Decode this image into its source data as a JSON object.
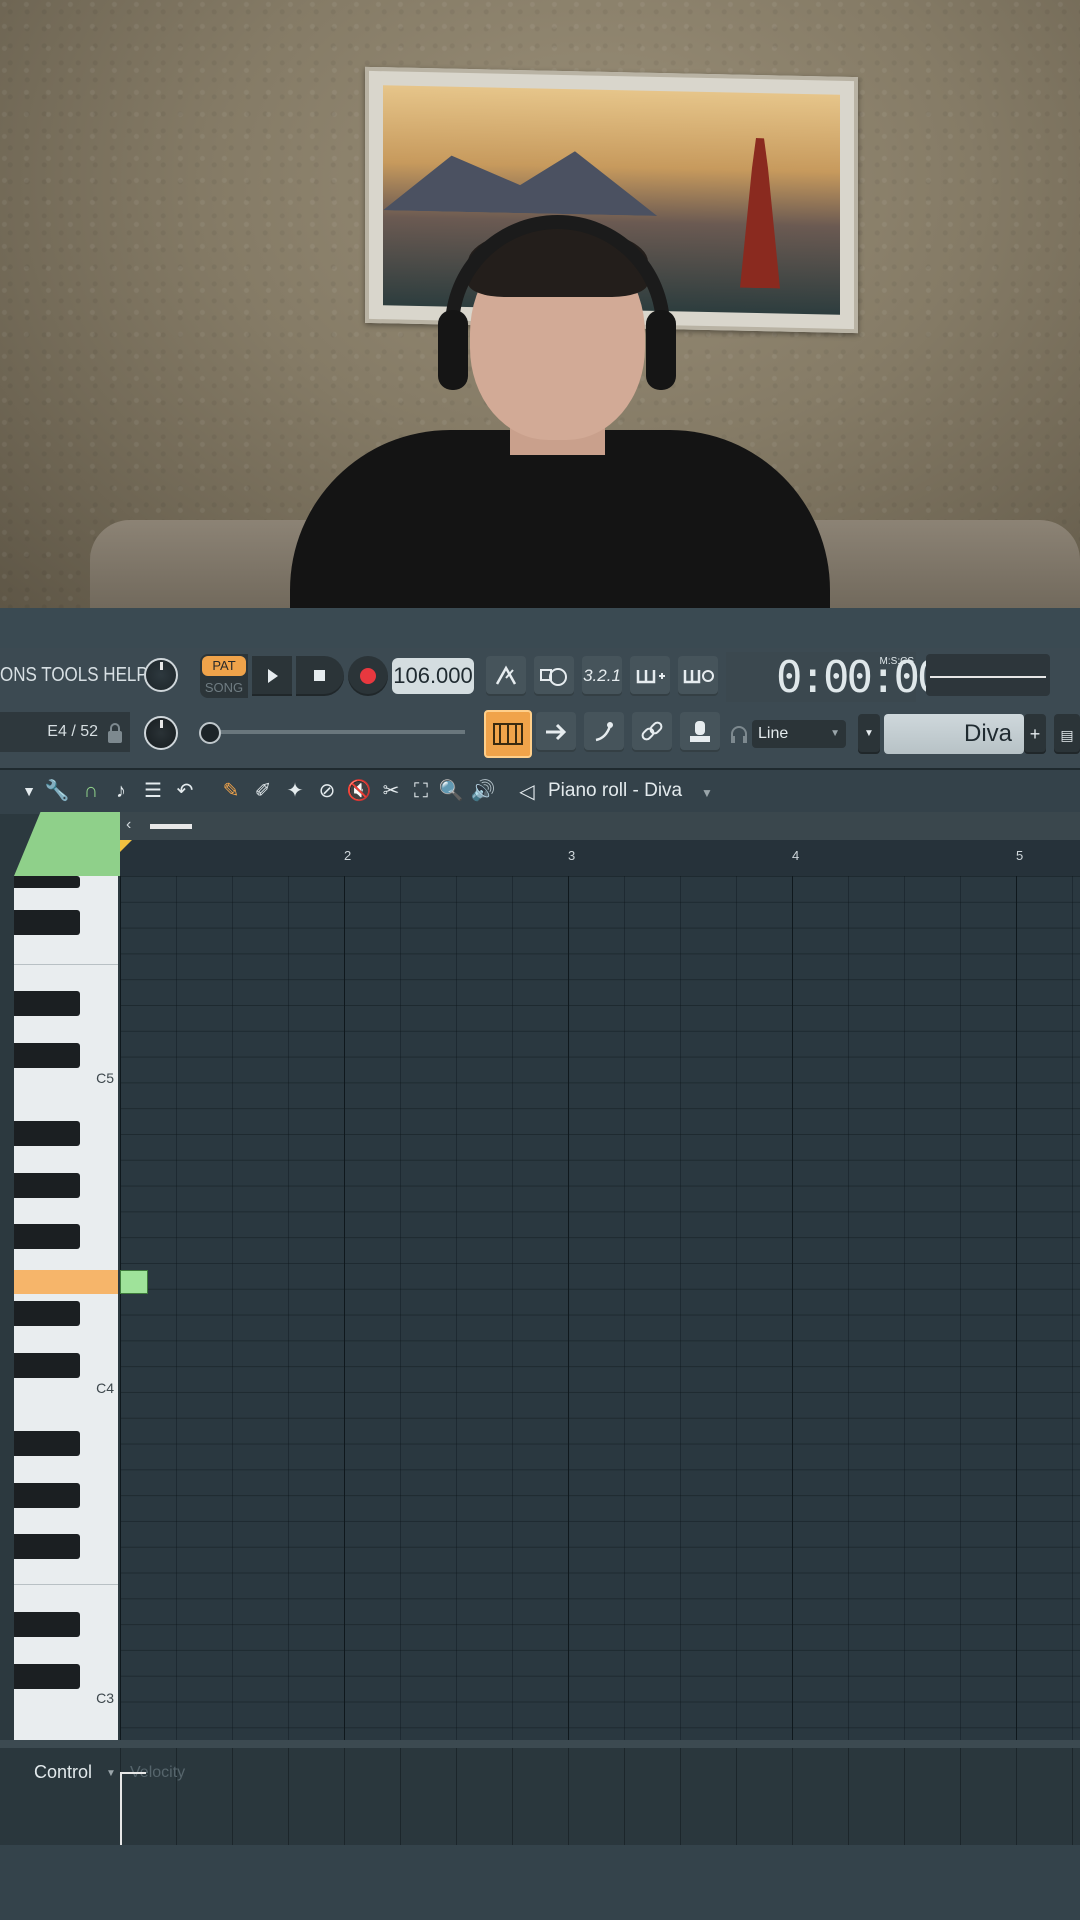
{
  "menu": {
    "text": "ONS TOOLS HELP"
  },
  "transport": {
    "pat_label": "PAT",
    "song_label": "SONG",
    "play_icon": "play-icon",
    "stop_icon": "stop-icon",
    "record_icon": "record-icon",
    "tempo": "106.000",
    "time": "0:00:00",
    "time_format": "M:S:CS"
  },
  "position": {
    "hint": "E4 / 52"
  },
  "snap": {
    "value": "Line"
  },
  "instrument": {
    "name": "Diva",
    "add_label": "+"
  },
  "piano_roll": {
    "title": "Piano roll - Diva",
    "bar_numbers": [
      "2",
      "3",
      "4",
      "5"
    ],
    "key_labels": [
      "C5",
      "C4",
      "C3"
    ],
    "note": {
      "pitch": "E4",
      "start_bar": 1
    }
  },
  "control": {
    "label": "Control",
    "target": "Velocity"
  },
  "colors": {
    "accent": "#f0a34a",
    "note": "#9fe39a",
    "grid": "#2a3840"
  }
}
